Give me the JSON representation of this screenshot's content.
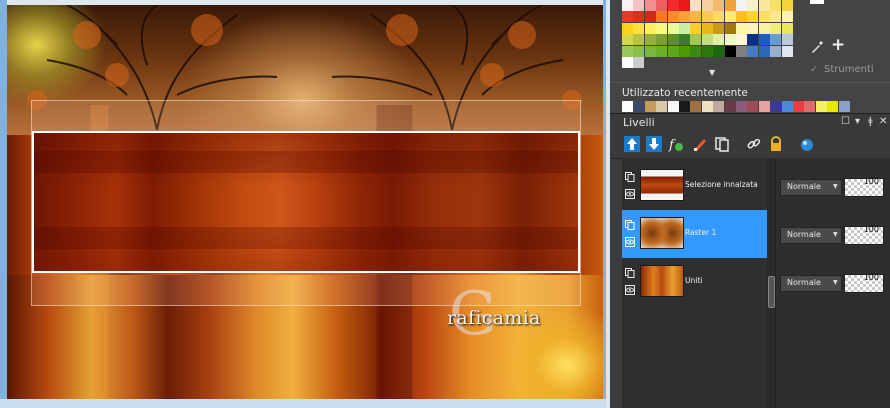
{
  "canvas": {
    "watermark_letter": "G",
    "watermark_text": "raficamia"
  },
  "materials": {
    "palette_rows": [
      [
        "#f7f3f3",
        "#f4c4c4",
        "#f29090",
        "#ef5d5d",
        "#ec2b2b",
        "#e61a1a",
        "#f7e0c4",
        "#f5cfa0",
        "#f3b96e",
        "#f1a23d",
        "#f3f3f3",
        "#f8f0c8",
        "#f8e89c",
        "#f7df6c",
        "#f6d53c"
      ],
      [
        "#e43a2e",
        "#d83020",
        "#cc2a1a",
        "#f47a2a",
        "#f58d2f",
        "#f6a03a",
        "#f7b34a",
        "#f8c65a",
        "#f9d96a",
        "#fae87a",
        "#ffc10e",
        "#fbd23c",
        "#fcdd66",
        "#fde890",
        "#fef2b8"
      ],
      [
        "#ffd11a",
        "#ffe13a",
        "#fff05a",
        "#f8f87a",
        "#e8f89a",
        "#c8f0a0",
        "#ffcc2a",
        "#e8b81a",
        "#c89a10",
        "#a07a08",
        "#fff7a6",
        "#fff0c0",
        "#f6f3a0",
        "#f0ee7a",
        "#e8e85a"
      ],
      [
        "#d6d64a",
        "#b8c440",
        "#98b03a",
        "#7aa034",
        "#5c8e2e",
        "#3e7c28",
        "#a0c858",
        "#c0e080",
        "#e0f0a0",
        "#f0f8c0",
        "#fff8d8",
        "#0c2f8a",
        "#1c5cc8",
        "#6a9ad8",
        "#b8c8e0"
      ],
      [
        "#9ac85a",
        "#8ac04a",
        "#7ab83a",
        "#6ab02a",
        "#5aa81a",
        "#4a9a0a",
        "#3a8a0a",
        "#2a7a0a",
        "#1a6a0a",
        "#000000",
        "#808080",
        "#4a7ac0",
        "#2a6ab8",
        "#9ab0c8",
        "#e0e6ee"
      ],
      [
        "#ffffff",
        "#cccccc"
      ]
    ],
    "recent_colors": [
      "#ffffff",
      "#3b4a6a",
      "#c89a5a",
      "#d8c8a8",
      "#f8f8f8",
      "#1a1a1a",
      "#a07040",
      "#f0e0c0",
      "#c0a8a0",
      "#6a3a4a",
      "#8a5a7a",
      "#a04a5a",
      "#e8a0a0",
      "#3a3a9a",
      "#4a8ad8",
      "#e84040",
      "#e06a6a",
      "#f0f060",
      "#e8e800",
      "#8aa0c8"
    ],
    "strumenti_label": "Strumenti",
    "recent_label": "Utilizzato recentemente"
  },
  "layers": {
    "title": "Livelli",
    "items": [
      {
        "name": "Selezione innalzata",
        "blend": "Normale",
        "opacity": "100",
        "selected": false
      },
      {
        "name": "Raster 1",
        "blend": "Normale",
        "opacity": "100",
        "selected": true
      },
      {
        "name": "Uniti",
        "blend": "Normale",
        "opacity": "100",
        "selected": false
      }
    ]
  }
}
